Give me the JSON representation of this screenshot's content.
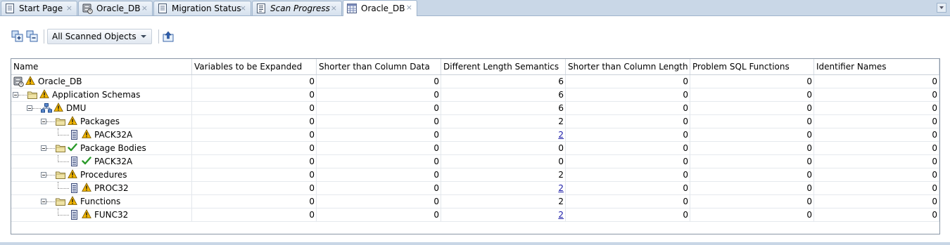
{
  "tabs": [
    {
      "label": "Start Page",
      "icon": "page-icon",
      "active": false,
      "italic": false
    },
    {
      "label": "Oracle_DB",
      "icon": "database-warning-icon",
      "active": false,
      "italic": false
    },
    {
      "label": "Migration Status",
      "icon": "page-icon",
      "active": false,
      "italic": false
    },
    {
      "label": "Scan Progress",
      "icon": "page-lines-icon",
      "active": false,
      "italic": true
    },
    {
      "label": "Oracle_DB",
      "icon": "grid-table-icon",
      "active": true,
      "italic": false
    }
  ],
  "toolbar": {
    "expand_icon": "expand-all-icon",
    "collapse_icon": "collapse-all-icon",
    "filter_value": "All Scanned Objects",
    "export_icon": "export-icon"
  },
  "columns": [
    "Name",
    "Variables to be Expanded",
    "Shorter than Column Data",
    "Different Length Semantics",
    "Shorter than Column Length",
    "Problem SQL Functions",
    "Identifier Names"
  ],
  "rows": [
    {
      "name": "Oracle_DB",
      "icon": "database-icon",
      "status": "warning",
      "level": 0,
      "expandable": false,
      "values": [
        "0",
        "0",
        "6",
        "0",
        "0",
        "0"
      ],
      "link": false
    },
    {
      "name": "Application Schemas",
      "icon": "folder-icon",
      "status": "warning",
      "level": 0,
      "expandable": true,
      "values": [
        "0",
        "0",
        "6",
        "0",
        "0",
        "0"
      ],
      "link": false
    },
    {
      "name": "DMU",
      "icon": "schema-icon",
      "status": "warning",
      "level": 1,
      "expandable": true,
      "values": [
        "0",
        "0",
        "6",
        "0",
        "0",
        "0"
      ],
      "link": false
    },
    {
      "name": "Packages",
      "icon": "folder-icon",
      "status": "warning",
      "level": 2,
      "expandable": true,
      "values": [
        "0",
        "0",
        "2",
        "0",
        "0",
        "0"
      ],
      "link": false
    },
    {
      "name": "PACK32A",
      "icon": "object-icon",
      "status": "warning",
      "level": 3,
      "expandable": false,
      "values": [
        "0",
        "0",
        "2",
        "0",
        "0",
        "0"
      ],
      "link": true
    },
    {
      "name": "Package Bodies",
      "icon": "folder-icon",
      "status": "ok",
      "level": 2,
      "expandable": true,
      "values": [
        "0",
        "0",
        "0",
        "0",
        "0",
        "0"
      ],
      "link": false
    },
    {
      "name": "PACK32A",
      "icon": "object-icon",
      "status": "ok",
      "level": 3,
      "expandable": false,
      "values": [
        "0",
        "0",
        "0",
        "0",
        "0",
        "0"
      ],
      "link": false
    },
    {
      "name": "Procedures",
      "icon": "folder-icon",
      "status": "warning",
      "level": 2,
      "expandable": true,
      "values": [
        "0",
        "0",
        "2",
        "0",
        "0",
        "0"
      ],
      "link": false
    },
    {
      "name": "PROC32",
      "icon": "object-icon",
      "status": "warning",
      "level": 3,
      "expandable": false,
      "values": [
        "0",
        "0",
        "2",
        "0",
        "0",
        "0"
      ],
      "link": true
    },
    {
      "name": "Functions",
      "icon": "folder-icon",
      "status": "warning",
      "level": 2,
      "expandable": true,
      "values": [
        "0",
        "0",
        "2",
        "0",
        "0",
        "0"
      ],
      "link": false
    },
    {
      "name": "FUNC32",
      "icon": "object-icon",
      "status": "warning",
      "level": 3,
      "expandable": false,
      "values": [
        "0",
        "0",
        "2",
        "0",
        "0",
        "0"
      ],
      "link": true
    }
  ],
  "colors": {
    "warning": "#f0b400",
    "ok": "#2a9a2a",
    "link": "#1a1aa6",
    "folder": "#d9c97a",
    "tab_bg": "#c9d7e7"
  }
}
